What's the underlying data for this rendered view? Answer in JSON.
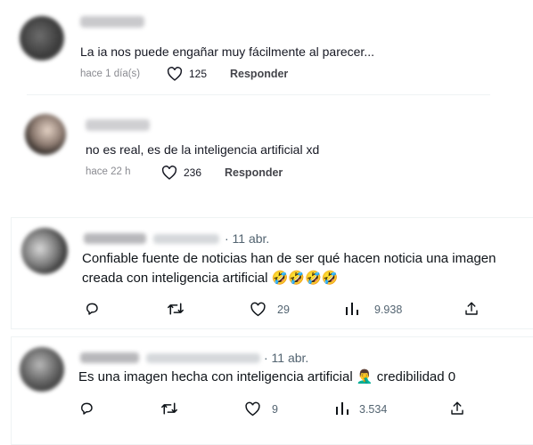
{
  "tiktok_comments": [
    {
      "text": "La ia nos puede engañar muy fácilmente al parecer...",
      "time": "hace 1 día(s)",
      "likes": "125",
      "reply_label": "Responder"
    },
    {
      "text": "no es real, es de la inteligencia artificial xd",
      "time": "hace 22 h",
      "likes": "236",
      "reply_label": "Responder"
    }
  ],
  "tweets": [
    {
      "date": "· 11 abr.",
      "line1": "Confiable fuente de noticias han de ser qué hacen noticia una imagen",
      "line2": "creada con inteligencia artificial",
      "emoji": "🤣🤣🤣🤣",
      "replies": "",
      "retweets": "",
      "likes": "29",
      "views": "9.938"
    },
    {
      "date": "· 11 abr.",
      "line1": "Es una imagen hecha con inteligencia artificial",
      "emoji": "🤦‍♂️",
      "line2": "credibilidad 0",
      "replies": "",
      "retweets": "",
      "likes": "9",
      "views": "3.534"
    }
  ],
  "icons": [
    "heart-icon",
    "reply-icon",
    "retweet-icon",
    "views-icon",
    "share-icon"
  ],
  "colors": {
    "tiktok_text": "#161823",
    "meta_gray": "#8a8b91",
    "twitter_gray": "#536471",
    "twitter_text": "#0f1419"
  }
}
